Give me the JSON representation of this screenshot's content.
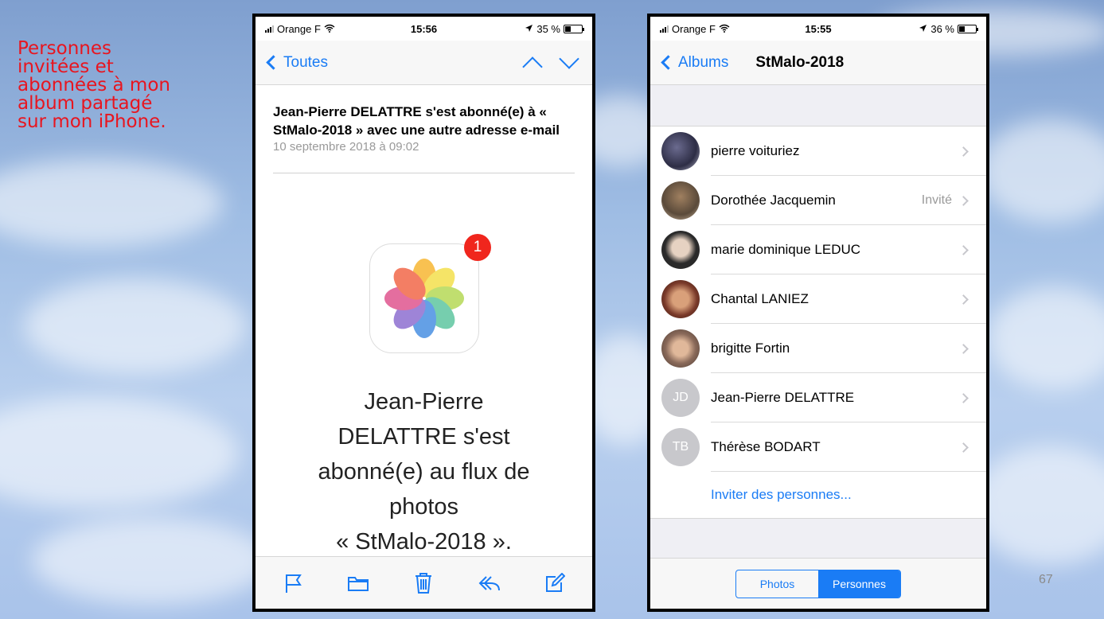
{
  "slide": {
    "caption_lines": [
      "Personnes",
      "invitées et",
      "abonnées à mon",
      "album partagé",
      "sur mon iPhone."
    ],
    "page_number": "67"
  },
  "left_phone": {
    "status_bar": {
      "carrier": "Orange F",
      "time": "15:56",
      "battery": "35 %",
      "battery_level": 0.35
    },
    "nav": {
      "back_label": "Toutes"
    },
    "mail": {
      "subject": "Jean-Pierre DELATTRE s'est abonné(e) à « StMalo-2018 » avec une autre adresse e-mail",
      "date": "10 septembre 2018 à 09:02",
      "badge_count": "1",
      "body_lines": [
        "Jean-Pierre",
        "DELATTRE s'est",
        "abonné(e) au flux de",
        "photos",
        "« StMalo-2018 »."
      ]
    },
    "toolbar_icons": [
      "flag-icon",
      "folder-icon",
      "trash-icon",
      "reply-icon",
      "compose-icon"
    ]
  },
  "right_phone": {
    "status_bar": {
      "carrier": "Orange F",
      "time": "15:55",
      "battery": "36 %",
      "battery_level": 0.36
    },
    "nav": {
      "back_label": "Albums",
      "title": "StMalo-2018"
    },
    "people": [
      {
        "name": "pierre voituriez",
        "status": "",
        "initials": ""
      },
      {
        "name": "Dorothée Jacquemin",
        "status": "Invité",
        "initials": ""
      },
      {
        "name": "marie dominique LEDUC",
        "status": "",
        "initials": ""
      },
      {
        "name": "Chantal LANIEZ",
        "status": "",
        "initials": ""
      },
      {
        "name": "brigitte Fortin",
        "status": "",
        "initials": ""
      },
      {
        "name": "Jean-Pierre DELATTRE",
        "status": "",
        "initials": "JD"
      },
      {
        "name": "Thérèse BODART",
        "status": "",
        "initials": "TB"
      }
    ],
    "invite_label": "Inviter des personnes...",
    "segments": {
      "photos": "Photos",
      "people": "Personnes",
      "selected": "Personnes"
    }
  },
  "colors": {
    "caption": "#e8151f",
    "ios_blue": "#1a7cf5",
    "badge": "#f0261d"
  }
}
